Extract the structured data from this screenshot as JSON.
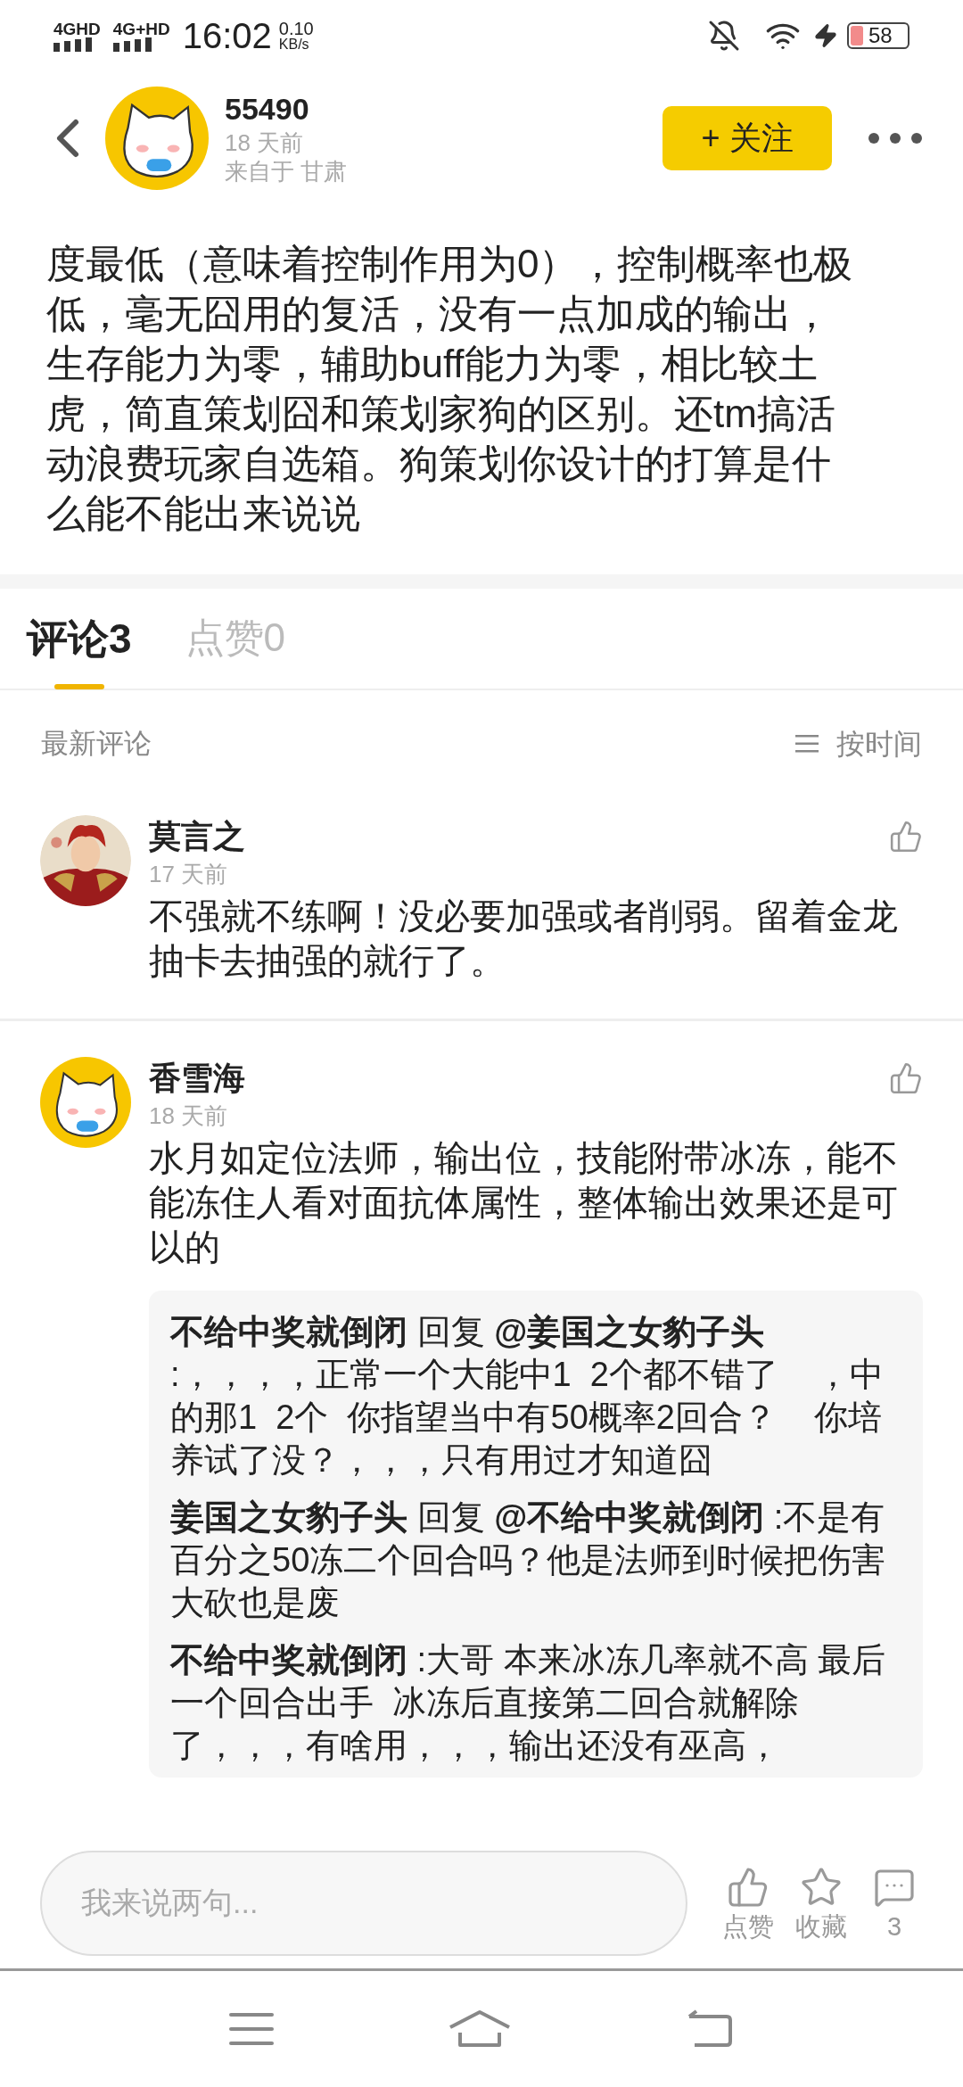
{
  "status_bar": {
    "network_1": "4GHD",
    "network_2": "4G+HD",
    "time": "16:02",
    "speed": "0.10",
    "speed_unit": "KB/s",
    "battery": "58"
  },
  "header": {
    "username": "55490",
    "time": "18 天前",
    "location": "来自于 甘肃",
    "follow_button": "+ 关注"
  },
  "post": {
    "text": "度最低（意味着控制作用为0），控制概率也极低，毫无囧用的复活，没有一点加成的输出，生存能力为零，辅助buff能力为零，相比较土虎，简直策划囧和策划家狗的区别。还tm搞活动浪费玩家自选箱。狗策划你设计的打算是什么能不能出来说说"
  },
  "tabs": [
    {
      "label": "评论3",
      "selected": true
    },
    {
      "label": "点赞0",
      "selected": false
    }
  ],
  "sort": {
    "title": "最新评论",
    "option": "按时间"
  },
  "comments": [
    {
      "name": "莫言之",
      "time": "17 天前",
      "kind": "picture",
      "text": "不强就不练啊！没必要加强或者削弱。留着金龙抽卡去抽强的就行了。"
    },
    {
      "name": "香雪海",
      "time": "18 天前",
      "kind": "cat",
      "text": "水月如定位法师，输出位，技能附带冰冻，能不能冻住人看对面抗体属性，整体输出效果还是可以的",
      "replies": [
        "**不给中奖就倒闭** 回复 **@姜国之女豹子头** :，，，，正常一个大能中1  2个都不错了    ，中的那1  2个  你指望当中有50概率2回合？    你培养试了没？，，，只有用过才知道囧",
        "**姜国之女豹子头** 回复 **@不给中奖就倒闭** :不是有百分之50冻二个回合吗？他是法师到时候把伤害大砍也是废",
        "**不给中奖就倒闭** :大哥 本来冰冻几率就不高 最后一个回合出手  冰冻后直接第二回合就解除了，，，有啥用，，，输出还没有巫高，"
      ]
    }
  ],
  "bottom_bar": {
    "placeholder": "我来说两句...",
    "actions": [
      {
        "kind": "like",
        "label": "点赞"
      },
      {
        "kind": "favorite",
        "label": "收藏"
      },
      {
        "kind": "comment",
        "label": "3"
      }
    ]
  }
}
